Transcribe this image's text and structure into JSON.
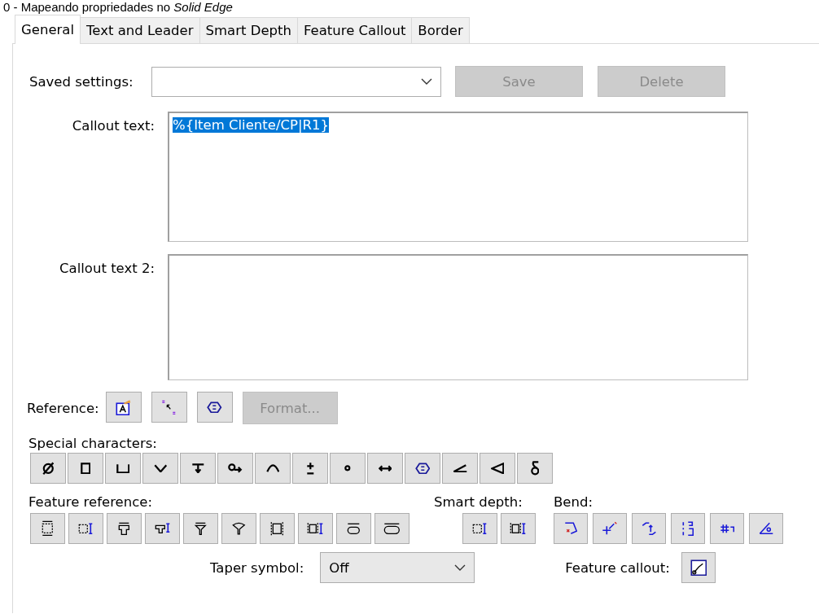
{
  "caption": "0 - Mapeando propriedades no *Solid Edge*",
  "tabs": [
    {
      "label": "General",
      "selected": true
    },
    {
      "label": "Text and Leader",
      "selected": false
    },
    {
      "label": "Smart Depth",
      "selected": false
    },
    {
      "label": "Feature Callout",
      "selected": false
    },
    {
      "label": "Border",
      "selected": false
    }
  ],
  "saved_settings": {
    "label": "Saved settings:",
    "buttons": [
      {
        "label": "Save",
        "disabled": true
      },
      {
        "label": "Delete",
        "disabled": true
      }
    ]
  },
  "callout_text": {
    "label": "Callout text:",
    "value": "%{Item Cliente/CP|R1}",
    "selected": true
  },
  "callout_text_2": {
    "label": "Callout text 2:"
  },
  "reference": {
    "label": "Reference:",
    "buttons": [
      {
        "kind": "properties"
      },
      {
        "kind": "scale"
      },
      {
        "kind": "statistical"
      }
    ],
    "format_button": {
      "label": "Format...",
      "disabled": true
    }
  },
  "special_characters": {
    "label": "Special characters:",
    "buttons": [
      {
        "kind": "diameter"
      },
      {
        "kind": "square"
      },
      {
        "kind": "counterbore"
      },
      {
        "kind": "countersink"
      },
      {
        "kind": "depth"
      },
      {
        "kind": "spotface"
      },
      {
        "kind": "arc"
      },
      {
        "kind": "plusminus"
      },
      {
        "kind": "degree"
      },
      {
        "kind": "between"
      },
      {
        "kind": "statistical"
      },
      {
        "kind": "slope"
      },
      {
        "kind": "taper"
      },
      {
        "kind": "delta"
      }
    ]
  },
  "feature_reference": {
    "label": "Feature reference:",
    "buttons": [
      {
        "kind": "hole"
      },
      {
        "kind": "holedepth"
      },
      {
        "kind": "cbore"
      },
      {
        "kind": "cboredepth"
      },
      {
        "kind": "csink"
      },
      {
        "kind": "csinkwide"
      },
      {
        "kind": "thread"
      },
      {
        "kind": "threaddepth"
      },
      {
        "kind": "slot"
      },
      {
        "kind": "slotwide"
      }
    ]
  },
  "smart_depth": {
    "label": "Smart depth:",
    "buttons": [
      {
        "kind": "holedepth"
      },
      {
        "kind": "threaddepth"
      }
    ]
  },
  "bend": {
    "label": "Bend:",
    "buttons": [
      {
        "kind": "bendcorner"
      },
      {
        "kind": "bendpoint"
      },
      {
        "kind": "bendstep"
      },
      {
        "kind": "bendlines"
      },
      {
        "kind": "bendcount"
      },
      {
        "kind": "bendangle"
      }
    ]
  },
  "taper_symbol": {
    "label": "Taper symbol:",
    "value": "Off"
  },
  "feature_callout": {
    "label": "Feature callout:",
    "buttons": [
      {
        "kind": "callout"
      }
    ]
  }
}
